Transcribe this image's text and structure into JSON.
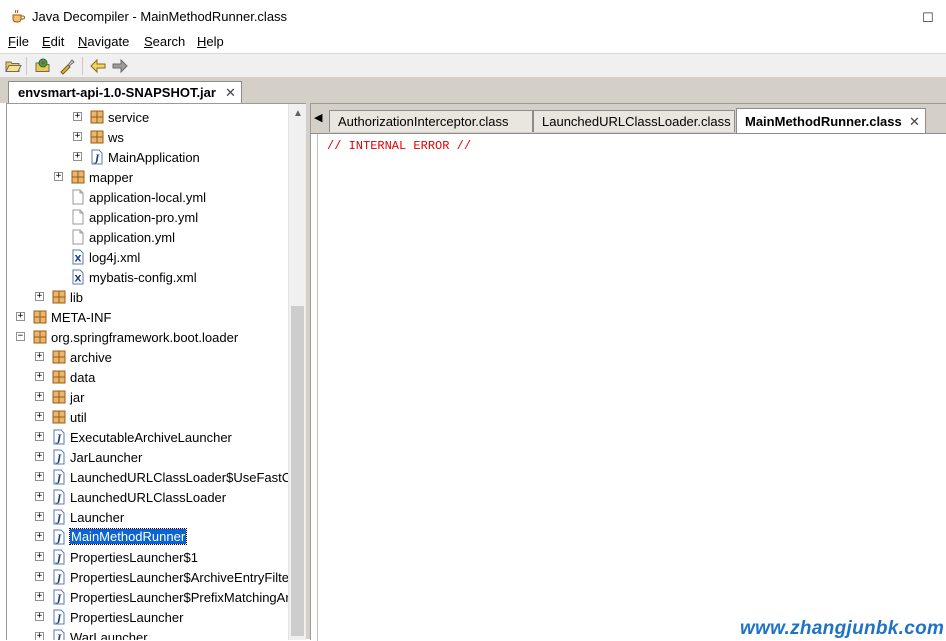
{
  "window": {
    "title": "Java Decompiler - MainMethodRunner.class",
    "icon": "coffee-cup-icon"
  },
  "menu": [
    {
      "mnemonic": "F",
      "rest": "ile"
    },
    {
      "mnemonic": "E",
      "rest": "dit"
    },
    {
      "mnemonic": "N",
      "rest": "avigate"
    },
    {
      "mnemonic": "S",
      "rest": "earch"
    },
    {
      "mnemonic": "H",
      "rest": "elp"
    }
  ],
  "toolbar": {
    "items": [
      "open-folder-icon",
      "open-type-icon",
      "search-flashlight-icon",
      "back-arrow-icon",
      "forward-arrow-icon"
    ]
  },
  "file_tab": {
    "label": "envsmart-api-1.0-SNAPSHOT.jar",
    "close": "✕"
  },
  "tree": {
    "nodes": [
      {
        "label": "service",
        "kind": "package",
        "expander": "+"
      },
      {
        "label": "ws",
        "kind": "package",
        "expander": "+"
      },
      {
        "label": "MainApplication",
        "kind": "class",
        "expander": "+"
      },
      {
        "label": "mapper",
        "kind": "package",
        "expander": "+"
      },
      {
        "label": "application-local.yml",
        "kind": "file",
        "expander": ""
      },
      {
        "label": "application-pro.yml",
        "kind": "file",
        "expander": ""
      },
      {
        "label": "application.yml",
        "kind": "file",
        "expander": ""
      },
      {
        "label": "log4j.xml",
        "kind": "xml",
        "expander": ""
      },
      {
        "label": "mybatis-config.xml",
        "kind": "xml",
        "expander": ""
      },
      {
        "label": "lib",
        "kind": "package",
        "expander": "+"
      },
      {
        "label": "META-INF",
        "kind": "package",
        "expander": "+"
      },
      {
        "label": "org.springframework.boot.loader",
        "kind": "package",
        "expander": "−"
      },
      {
        "label": "archive",
        "kind": "package",
        "expander": "+"
      },
      {
        "label": "data",
        "kind": "package",
        "expander": "+"
      },
      {
        "label": "jar",
        "kind": "package",
        "expander": "+"
      },
      {
        "label": "util",
        "kind": "package",
        "expander": "+"
      },
      {
        "label": "ExecutableArchiveLauncher",
        "kind": "class",
        "expander": "+"
      },
      {
        "label": "JarLauncher",
        "kind": "class",
        "expander": "+"
      },
      {
        "label": "LaunchedURLClassLoader$UseFastCo",
        "kind": "class",
        "expander": "+"
      },
      {
        "label": "LaunchedURLClassLoader",
        "kind": "class",
        "expander": "+"
      },
      {
        "label": "Launcher",
        "kind": "class",
        "expander": "+"
      },
      {
        "label": "MainMethodRunner",
        "kind": "class",
        "expander": "+",
        "selected": true
      },
      {
        "label": "PropertiesLauncher$1",
        "kind": "class",
        "expander": "+"
      },
      {
        "label": "PropertiesLauncher$ArchiveEntryFilter",
        "kind": "class",
        "expander": "+"
      },
      {
        "label": "PropertiesLauncher$PrefixMatchingAr",
        "kind": "class",
        "expander": "+"
      },
      {
        "label": "PropertiesLauncher",
        "kind": "class",
        "expander": "+"
      },
      {
        "label": "WarLauncher",
        "kind": "class",
        "expander": "+"
      }
    ]
  },
  "class_tabs": [
    {
      "label": "AuthorizationInterceptor.class",
      "active": false
    },
    {
      "label": "LaunchedURLClassLoader.class",
      "active": false
    },
    {
      "label": "MainMethodRunner.class",
      "active": true
    }
  ],
  "code": {
    "lines": [
      "// INTERNAL ERROR //"
    ]
  },
  "watermark": "www.zhangjunbk.com",
  "colors": {
    "selection": "#0a64d8",
    "error_text": "#e00000",
    "watermark": "#1e73c8",
    "package_icon": "#c07a2a"
  }
}
